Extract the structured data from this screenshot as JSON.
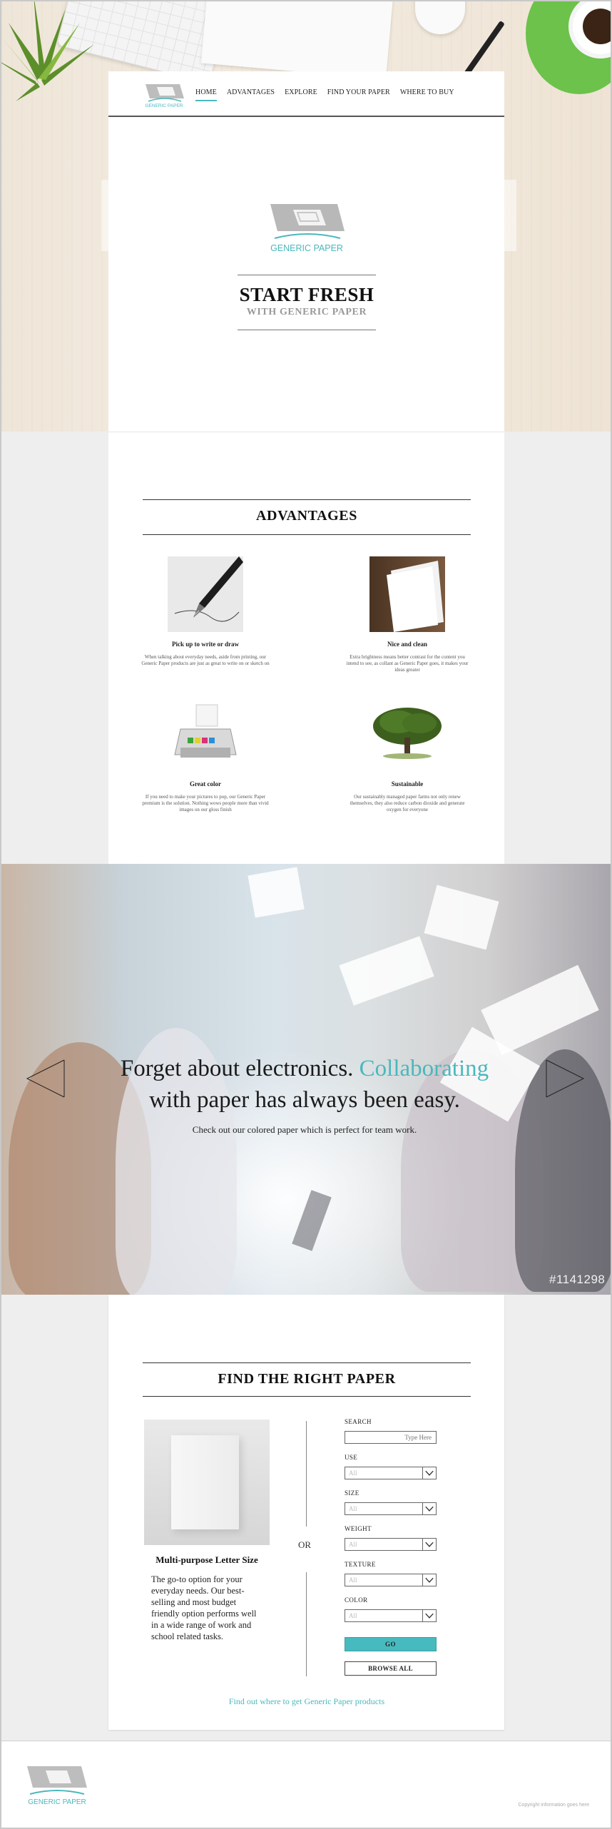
{
  "brand": {
    "name": "GENERIC PAPER",
    "accent_color": "#4ab8bd"
  },
  "nav": {
    "items": [
      {
        "label": "HOME",
        "active": true
      },
      {
        "label": "ADVANTAGES",
        "active": false
      },
      {
        "label": "EXPLORE",
        "active": false
      },
      {
        "label": "FIND YOUR PAPER",
        "active": false
      },
      {
        "label": "WHERE TO BUY",
        "active": false
      }
    ]
  },
  "hero": {
    "title": "START FRESH",
    "subtitle": "WITH GENERIC PAPER"
  },
  "advantages": {
    "title": "ADVANTAGES",
    "items": [
      {
        "title": "Pick up to write or draw",
        "text": "When talking about everyday needs, aside from printing, our Generic Paper products are just as great to write on or sketch on",
        "icon": "fountain-pen-image"
      },
      {
        "title": "Nice and clean",
        "text": "Extra brightness means better contrast for the content you intend to see, as collant as Generic Paper goes, it makes your ideas greater",
        "icon": "paper-sheets-image"
      },
      {
        "title": "Great color",
        "text": "If you need to make your pictures to pop, our Generic Paper premium is the solution. Nothing wows people more than vivid images on our gloss finish",
        "icon": "printer-image"
      },
      {
        "title": "Sustainable",
        "text": "Our sustainably managed paper farms not only renew themselves, they also reduce carbon dioxide and generate oxygen for everyone",
        "icon": "tree-image"
      }
    ]
  },
  "banner": {
    "line1_plain": "Forget about electronics. ",
    "line1_accent": "Collaborating",
    "line2": "with paper has always been easy.",
    "subtext": "Check out our colored paper which is perfect for team work.",
    "image_id": "#1141298"
  },
  "finder": {
    "title": "FIND THE RIGHT PAPER",
    "product": {
      "name": "Multi-purpose Letter Size",
      "description": "The go-to option for your everyday needs. Our best-selling and most budget friendly option performs well in a wide range of work and school related tasks."
    },
    "or_label": "OR",
    "search": {
      "label": "SEARCH",
      "placeholder": "Type Here"
    },
    "filters": [
      {
        "label": "USE",
        "value": "All"
      },
      {
        "label": "SIZE",
        "value": "All"
      },
      {
        "label": "WEIGHT",
        "value": "All"
      },
      {
        "label": "TEXTURE",
        "value": "All"
      },
      {
        "label": "COLOR",
        "value": "All"
      }
    ],
    "go_label": "GO",
    "browse_label": "BROWSE ALL",
    "where_link": "Find out where to get Generic Paper products"
  },
  "footer": {
    "copyright": "Copyright information goes here"
  }
}
